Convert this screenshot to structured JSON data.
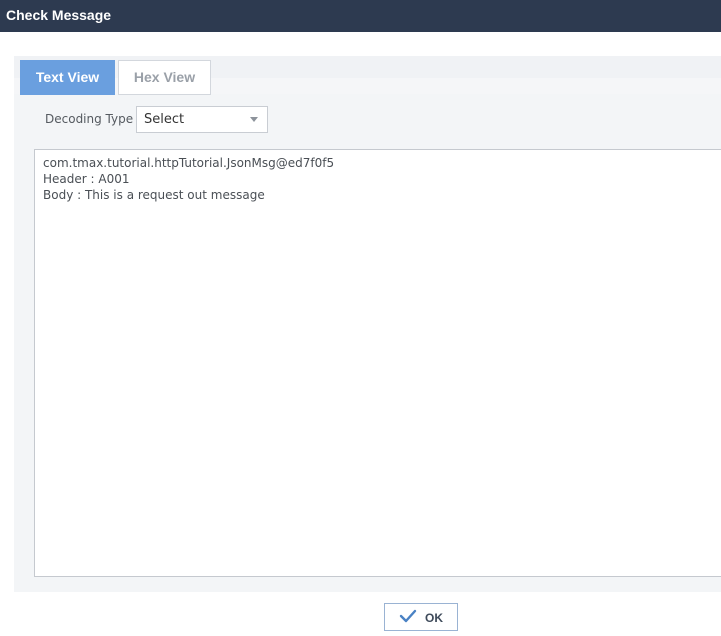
{
  "window": {
    "title": "Check Message"
  },
  "tabs": [
    {
      "label": "Text View",
      "active": true
    },
    {
      "label": "Hex View",
      "active": false
    }
  ],
  "decoding": {
    "label": "Decoding Type",
    "selected": "Select"
  },
  "message": {
    "lines": [
      "com.tmax.tutorial.httpTutorial.JsonMsg@ed7f0f5",
      "Header : A001",
      "Body : This is a request out message"
    ]
  },
  "footer": {
    "ok_label": "OK"
  },
  "colors": {
    "titlebar": "#2d3a50",
    "active_tab": "#6a9fdf",
    "check_icon": "#4a82c4"
  },
  "icons": {
    "ok": "check-icon",
    "select": "chevron-down-icon"
  }
}
